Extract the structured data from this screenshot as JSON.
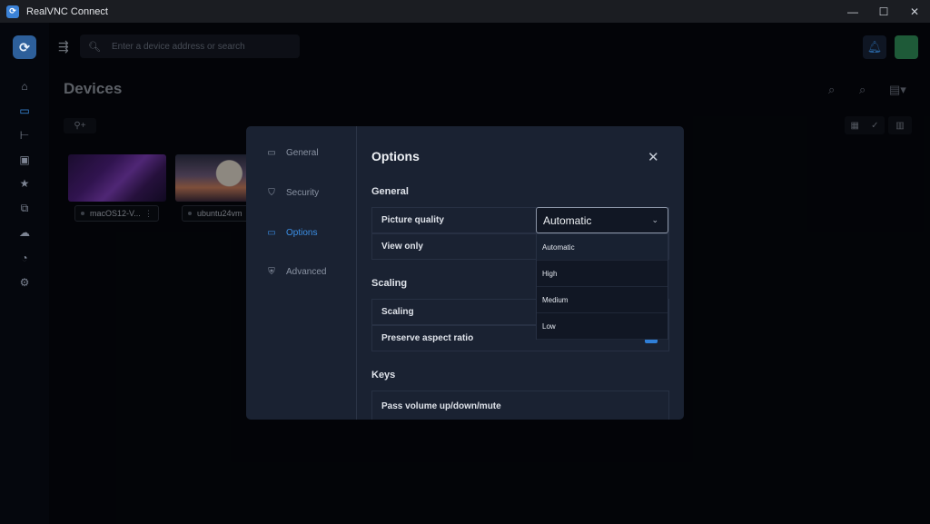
{
  "titlebar": {
    "title": "RealVNC Connect",
    "buttons": [
      "minimize",
      "maximize",
      "close"
    ]
  },
  "rail": {
    "items": [
      "home-icon",
      "devices-icon",
      "tree-icon",
      "address-book-icon",
      "star-icon",
      "group-icon",
      "cloud-icon",
      "connect-icon",
      "settings-icon"
    ],
    "active": "devices-icon"
  },
  "header": {
    "search_placeholder": "Enter a device address or search"
  },
  "page": {
    "title": "Devices"
  },
  "devices": [
    {
      "name": "macOS12-V..."
    },
    {
      "name": "ubuntu24vm"
    }
  ],
  "modal": {
    "nav": [
      {
        "label": "General",
        "icon": "laptop-icon"
      },
      {
        "label": "Security",
        "icon": "shield-icon"
      },
      {
        "label": "Options",
        "icon": "display-icon",
        "active": true
      },
      {
        "label": "Advanced",
        "icon": "advanced-shield-icon"
      }
    ],
    "title": "Options",
    "sections": {
      "general": {
        "title": "General",
        "picture_quality_label": "Picture quality",
        "picture_quality_value": "Automatic",
        "view_only_label": "View only"
      },
      "scaling": {
        "title": "Scaling",
        "scaling_label": "Scaling",
        "preserve_label": "Preserve aspect ratio"
      },
      "keys": {
        "title": "Keys",
        "pass_label": "Pass volume up/down/mute"
      }
    },
    "dropdown_options": [
      "Automatic",
      "High",
      "Medium",
      "Low"
    ],
    "dropdown_selected": "Automatic"
  },
  "colors": {
    "accent": "#3b8fe6",
    "modal_bg": "#1a2232",
    "app_bg": "#05070d"
  }
}
